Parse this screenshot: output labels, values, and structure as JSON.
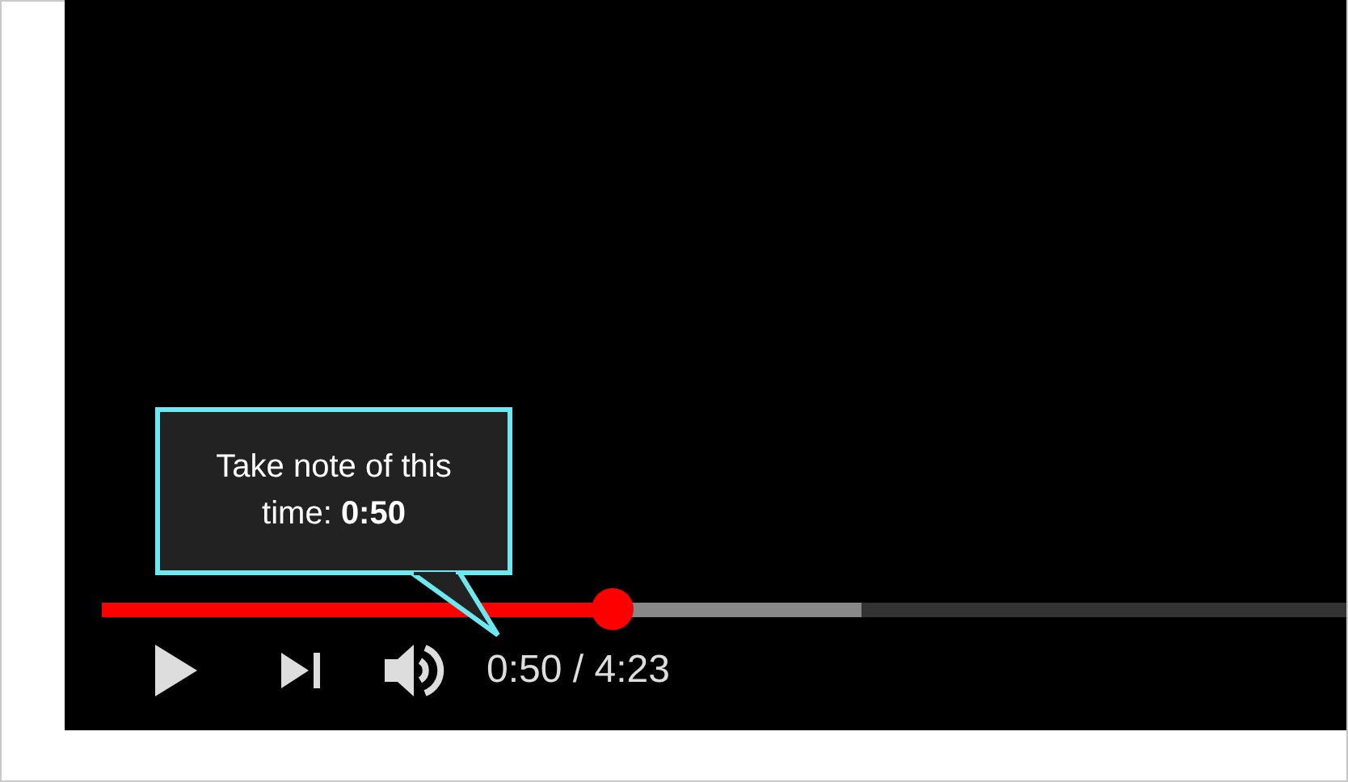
{
  "player": {
    "tooltip": {
      "text": "Take note of this time: **0:50**"
    },
    "progress": {
      "level": 0.41
    },
    "buffer": {
      "level": 0.61
    },
    "controls": {
      "play": {
        "playing": false
      },
      "time": "0:50 / 4:23"
    }
  }
}
